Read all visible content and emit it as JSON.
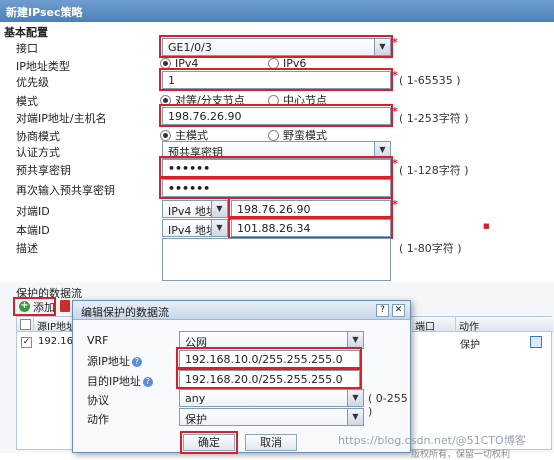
{
  "window": {
    "title": "新建IPsec策略"
  },
  "section_basic": "基本配置",
  "interface": {
    "label": "接口",
    "value": "GE1/0/3"
  },
  "ip_type": {
    "label": "IP地址类型",
    "options": [
      "IPv4",
      "IPv6"
    ],
    "selected": "IPv4"
  },
  "priority": {
    "label": "优先级",
    "value": "1",
    "hint": "( 1-65535 )"
  },
  "mode": {
    "label": "模式",
    "options": [
      "对等/分支节点",
      "中心节点"
    ],
    "selected": "对等/分支节点"
  },
  "peer_ip": {
    "label": "对端IP地址/主机名",
    "value": "198.76.26.90",
    "hint": "( 1-253字符 )"
  },
  "negotiation": {
    "label": "协商模式",
    "options": [
      "主模式",
      "野蛮模式"
    ],
    "selected": "主模式"
  },
  "auth": {
    "label": "认证方式",
    "value": "预共享密钥"
  },
  "psk": {
    "label": "预共享密钥",
    "value": "••••••",
    "hint": "( 1-128字符 )"
  },
  "psk_confirm": {
    "label": "再次输入预共享密钥",
    "value": "••••••"
  },
  "peer_id": {
    "label": "对端ID",
    "type": "IPv4 地址",
    "value": "198.76.26.90"
  },
  "local_id": {
    "label": "本端ID",
    "type": "IPv4 地址",
    "value": "101.88.26.34"
  },
  "desc": {
    "label": "描述",
    "hint": "( 1-80字符 )"
  },
  "protected": {
    "title": "保护的数据流",
    "add_label": "添加",
    "headers": {
      "src_ip": "源IP地址",
      "port": "端口",
      "action": "动作"
    },
    "row": {
      "src_ip": "192.168.",
      "action": "保护"
    }
  },
  "dialog": {
    "title": "编辑保护的数据流",
    "help": "?",
    "close": "✕",
    "vrf": {
      "label": "VRF",
      "value": "公网"
    },
    "src_ip": {
      "label": "源IP地址",
      "value": "192.168.10.0/255.255.255.0"
    },
    "dst_ip": {
      "label": "目的IP地址",
      "value": "192.168.20.0/255.255.255.0"
    },
    "protocol": {
      "label": "协议",
      "value": "any",
      "hint": "( 0-255 )"
    },
    "action": {
      "label": "动作",
      "value": "保护"
    },
    "ok": "确定",
    "cancel": "取消"
  },
  "watermark": "https://blog.csdn.net/@51CTO博客",
  "footer_note": "版权所有，保留一切权利"
}
